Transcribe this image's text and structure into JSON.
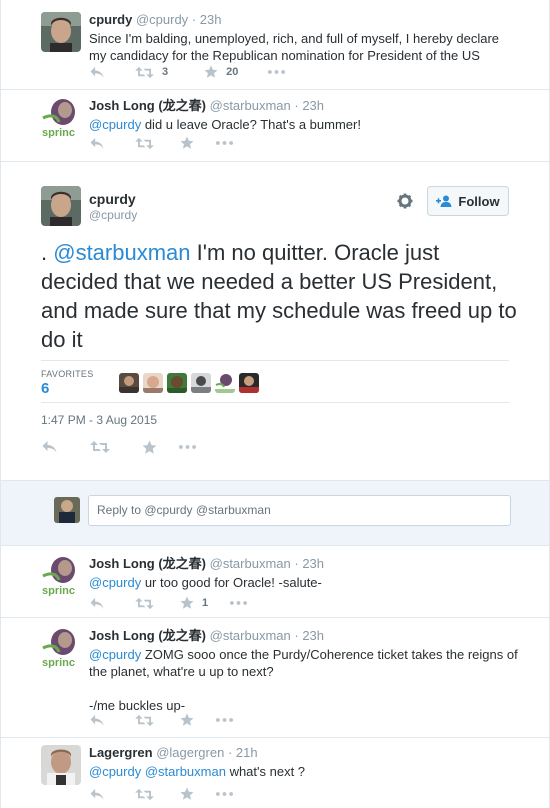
{
  "tweets": [
    {
      "name": "cpurdy",
      "handle": "@cpurdy",
      "time": "· 23h",
      "text": "Since I'm balding, unemployed, rich, and full of myself, I hereby declare my candidacy for the Republican nomination for President of the US",
      "retweets": "3",
      "favorites": "20"
    },
    {
      "name": "Josh Long (龙之春)",
      "handle": "@starbuxman",
      "time": "· 23h",
      "mention": "@cpurdy",
      "text": " did u leave Oracle? That's a bummer!"
    }
  ],
  "main_tweet": {
    "name": "cpurdy",
    "handle": "@cpurdy",
    "follow_label": "Follow",
    "text_prefix": ". ",
    "mention": "@starbuxman",
    "text": " I'm no quitter. Oracle just decided that we needed a better US President, and made sure that my schedule was freed up to do it",
    "favorites_label": "FAVORITES",
    "favorites_count": "6",
    "timestamp": "1:47 PM - 3 Aug 2015"
  },
  "reply_box": {
    "placeholder": "Reply to @cpurdy @starbuxman"
  },
  "replies": [
    {
      "name": "Josh Long (龙之春)",
      "handle": "@starbuxman",
      "time": "· 23h",
      "mention": "@cpurdy",
      "text": " ur too good for Oracle! -salute-",
      "favorites": "1"
    },
    {
      "name": "Josh Long (龙之春)",
      "handle": "@starbuxman",
      "time": "· 23h",
      "mention": "@cpurdy",
      "text": " ZOMG sooo once the Purdy/Coherence ticket takes the reigns of the planet, what're u up to next?",
      "text2": "-/me buckles up-"
    },
    {
      "name": "Lagergren",
      "handle": "@lagergren",
      "time": "· 21h",
      "mention": "@cpurdy @starbuxman",
      "text": " what's next ?"
    }
  ],
  "avatar_logo_text": "sprinc",
  "colors": {
    "link": "#2a8ad4",
    "muted": "#8899a6",
    "text": "#292f33",
    "action": "#b8c3cb",
    "reply_bg": "#eef4f9"
  },
  "icons": [
    "reply-icon",
    "retweet-icon",
    "favorite-icon",
    "more-icon",
    "gear-icon",
    "follow-person-icon"
  ]
}
